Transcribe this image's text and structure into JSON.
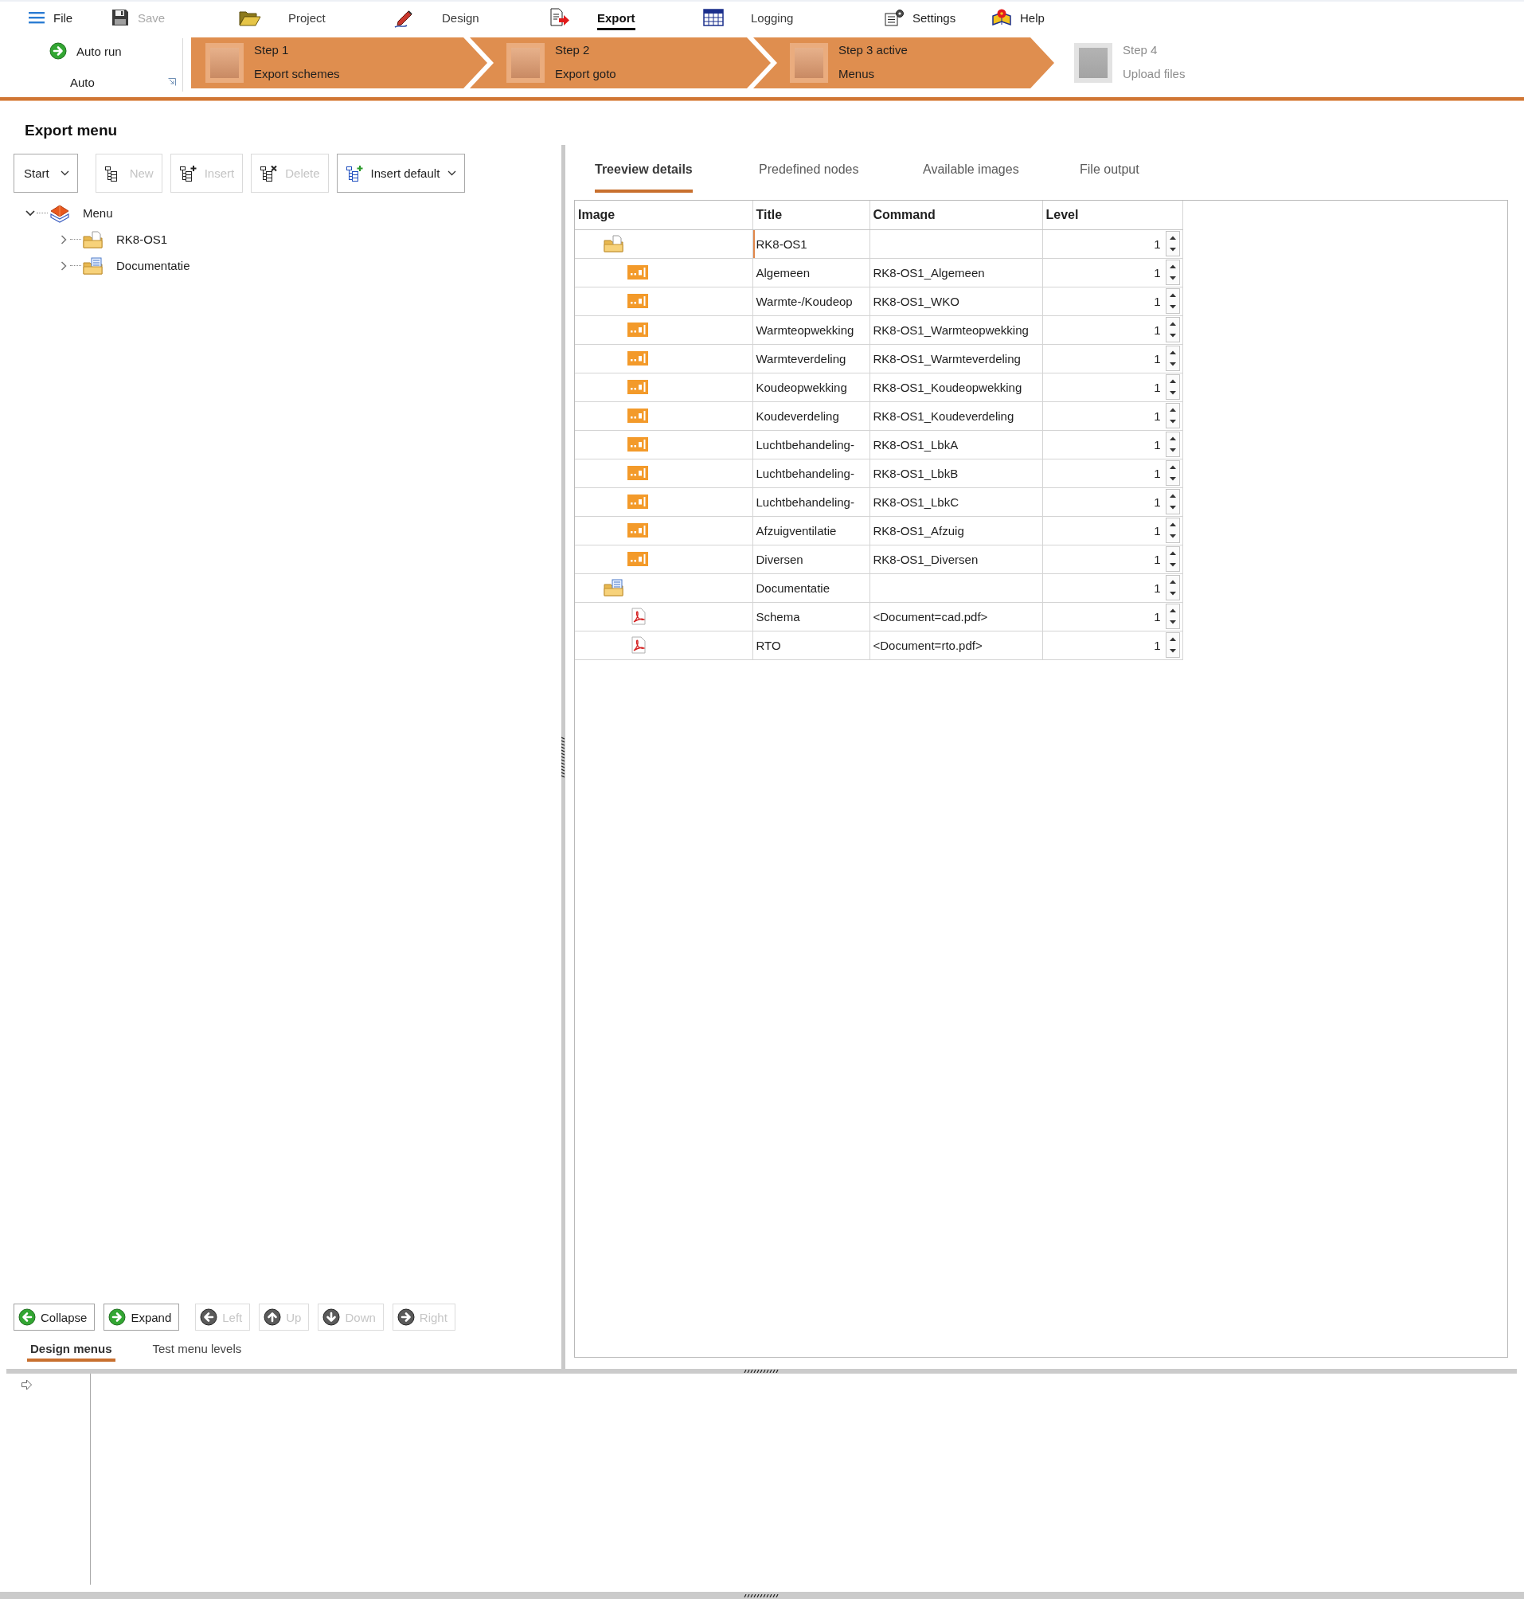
{
  "quick_access": [
    {
      "label": "File",
      "disabled": false
    },
    {
      "label": "Save",
      "disabled": true
    }
  ],
  "ribbon_tabs": [
    {
      "label": "Project",
      "selected": false
    },
    {
      "label": "Design",
      "selected": false
    },
    {
      "label": "Export",
      "selected": true
    },
    {
      "label": "Logging",
      "selected": false
    }
  ],
  "ribbon_buttons": [
    {
      "label": "Settings"
    },
    {
      "label": "Help"
    }
  ],
  "auto_group": {
    "button": "Auto run",
    "title": "Auto"
  },
  "steps": [
    {
      "title": "Step 1",
      "subtitle": "Export schemes",
      "disabled": false
    },
    {
      "title": "Step 2",
      "subtitle": "Export goto",
      "disabled": false
    },
    {
      "title": "Step 3 active",
      "subtitle": "Menus",
      "disabled": false
    },
    {
      "title": "Step 4",
      "subtitle": "Upload files",
      "disabled": true
    }
  ],
  "export_menu": {
    "title": "Export menu",
    "toolbar": [
      {
        "label": "Start",
        "kind": "dropdown",
        "disabled": false
      },
      {
        "label": "New",
        "kind": "button",
        "disabled": true
      },
      {
        "label": "Insert",
        "kind": "button",
        "disabled": true
      },
      {
        "label": "Delete",
        "kind": "button",
        "disabled": true
      },
      {
        "label": "Insert default",
        "kind": "dropdown",
        "disabled": false
      }
    ],
    "tree": [
      {
        "label": "Menu",
        "kind": "menu",
        "expanded": true,
        "children": [
          {
            "label": "RK8-OS1",
            "kind": "folder",
            "expanded": false
          },
          {
            "label": "Documentatie",
            "kind": "docs",
            "expanded": false
          }
        ]
      }
    ],
    "buttons": [
      {
        "label": "Collapse",
        "disabled": false
      },
      {
        "label": "Expand",
        "disabled": false
      },
      {
        "label": "Left",
        "disabled": true
      },
      {
        "label": "Up",
        "disabled": true
      },
      {
        "label": "Down",
        "disabled": true
      },
      {
        "label": "Right",
        "disabled": true
      }
    ],
    "tabs": [
      {
        "label": "Design menus",
        "selected": true
      },
      {
        "label": "Test menu levels",
        "selected": false
      }
    ]
  },
  "details": {
    "tabs": [
      {
        "label": "Treeview details",
        "selected": true
      },
      {
        "label": "Predefined nodes",
        "selected": false
      },
      {
        "label": "Available images",
        "selected": false
      },
      {
        "label": "File output",
        "selected": false
      }
    ],
    "table": {
      "columns": [
        "Image",
        "Title",
        "Command",
        "Level"
      ],
      "rows": [
        {
          "kind": "folder",
          "title": "RK8-OS1",
          "level_cell": "1",
          "selected": true
        },
        {
          "kind": "scheme",
          "title": "Algemeen",
          "command": "RK8-OS1_Algemeen",
          "level_cell": "1",
          "selected": false
        },
        {
          "kind": "scheme",
          "title": "Warmte-/Koudeop",
          "command": "RK8-OS1_WKO",
          "level_cell": "1",
          "selected": false
        },
        {
          "kind": "scheme",
          "title": "Warmteopwekking",
          "command": "RK8-OS1_Warmteopwekking",
          "level_cell": "1",
          "selected": false
        },
        {
          "kind": "scheme",
          "title": "Warmteverdeling",
          "command": "RK8-OS1_Warmteverdeling",
          "level_cell": "1",
          "selected": false
        },
        {
          "kind": "scheme",
          "title": "Koudeopwekking",
          "command": "RK8-OS1_Koudeopwekking",
          "level_cell": "1",
          "selected": false
        },
        {
          "kind": "scheme",
          "title": "Koudeverdeling",
          "command": "RK8-OS1_Koudeverdeling",
          "level_cell": "1",
          "selected": false
        },
        {
          "kind": "scheme",
          "title": "Luchtbehandeling-",
          "command": "RK8-OS1_LbkA",
          "level_cell": "1",
          "selected": false
        },
        {
          "kind": "scheme",
          "title": "Luchtbehandeling-",
          "command": "RK8-OS1_LbkB",
          "level_cell": "1",
          "selected": false
        },
        {
          "kind": "scheme",
          "title": "Luchtbehandeling-",
          "command": "RK8-OS1_LbkC",
          "level_cell": "1",
          "selected": false
        },
        {
          "kind": "scheme",
          "title": "Afzuigventilatie",
          "command": "RK8-OS1_Afzuig",
          "level_cell": "1",
          "selected": false
        },
        {
          "kind": "scheme",
          "title": "Diversen",
          "command": "RK8-OS1_Diversen",
          "level_cell": "1",
          "selected": false
        },
        {
          "kind": "docs",
          "title": "Documentatie",
          "level_cell": "1",
          "selected": false
        },
        {
          "kind": "pdf",
          "title": "Schema",
          "command": "<Document=cad.pdf>",
          "level_cell": "1",
          "selected": false
        },
        {
          "kind": "pdf",
          "title": "RTO",
          "command": "<Document=rto.pdf>",
          "level_cell": "1",
          "selected": false
        }
      ]
    }
  }
}
